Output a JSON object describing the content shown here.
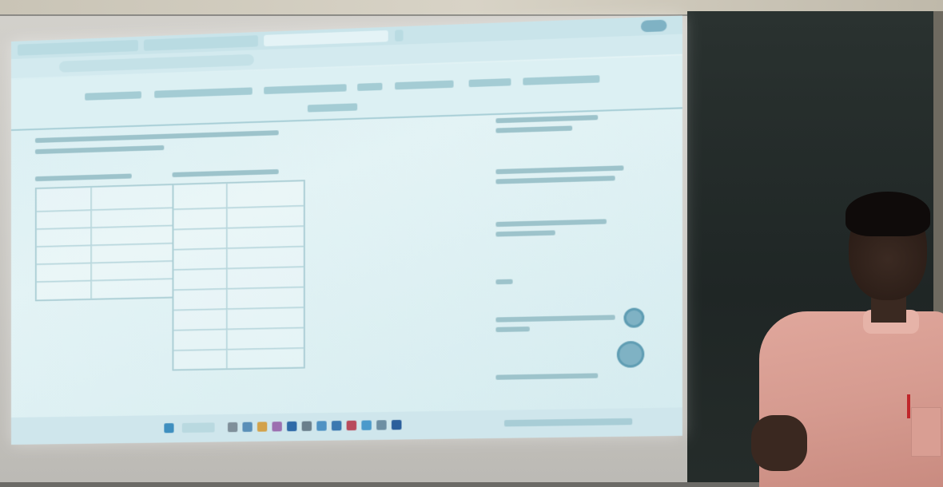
{
  "scene": {
    "subject": "",
    "elements": [
      "projection-screen",
      "blackboard",
      "presenter"
    ]
  },
  "projected_ui": {
    "browser_tabs_count": 4,
    "nav_rows": 2,
    "table_visible": true,
    "sidebar_cards_count": 6,
    "taskbar_visible": true
  },
  "colors": {
    "projection": "#dcf0f3",
    "blackboard": "#1f2625",
    "shirt": "#d69b90"
  }
}
